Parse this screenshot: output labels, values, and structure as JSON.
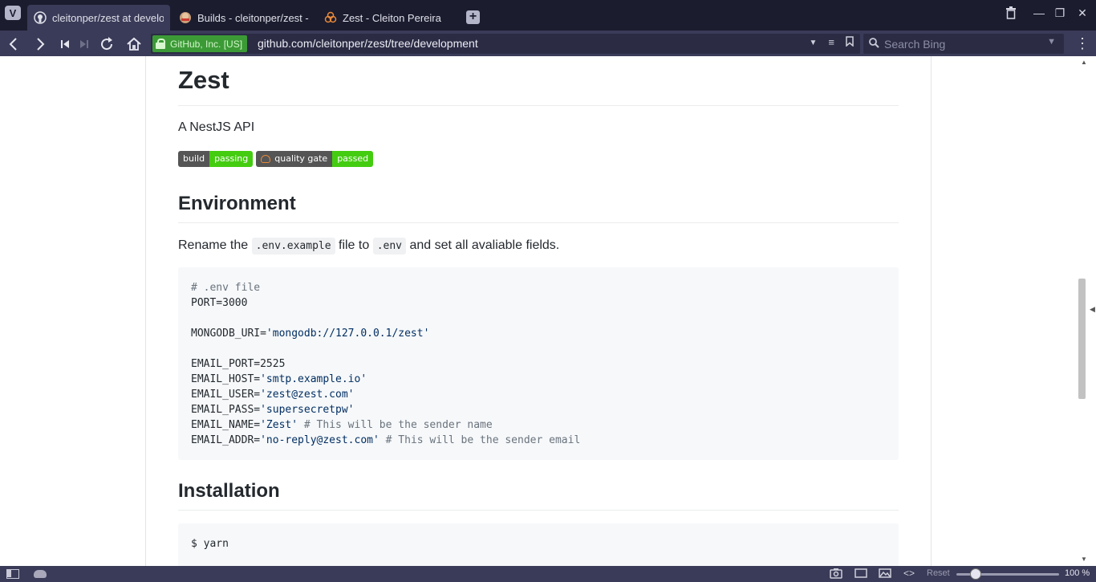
{
  "browser": {
    "menu_glyph": "V",
    "tabs": [
      {
        "label": "cleitonper/zest at development",
        "icon": "github-icon"
      },
      {
        "label": "Builds - cleitonper/zest - Travis CI",
        "icon": "travis-icon"
      },
      {
        "label": "Zest - Cleiton Pereira",
        "icon": "sonarcloud-icon"
      }
    ],
    "new_tab_glyph": "+",
    "window_buttons": {
      "trash": "🗑",
      "minimize": "—",
      "restore": "❐",
      "close": "✕"
    }
  },
  "address_bar": {
    "cert_label": "GitHub, Inc. [US]",
    "url": "github.com/cleitonper/zest/tree/development",
    "search_placeholder": "Search Bing",
    "nav": {
      "back": "‹",
      "forward": "›",
      "rewind": "⏮",
      "fastforward": "⏭",
      "reload": "↻",
      "home": "⌂"
    },
    "url_icons": {
      "dropdown": "▼",
      "reader": "≡",
      "bookmark": "🔖"
    },
    "search_icon": "🔍",
    "search_dropdown": "▼",
    "kebab": "⋮"
  },
  "readme": {
    "title": "Zest",
    "description": "A NestJS API",
    "badges": [
      {
        "left": "build",
        "right": "passing",
        "right_color": "#44cc11"
      },
      {
        "left": "quality gate",
        "right": "passed",
        "right_color": "#44cc11"
      }
    ],
    "environment": {
      "heading": "Environment",
      "text_before": "Rename the",
      "code1": ".env.example",
      "text_middle": "file to",
      "code2": ".env",
      "text_after": "and set all avaliable fields.",
      "lines": [
        {
          "key": "",
          "value": "",
          "comment": "# .env file"
        },
        {
          "key": "PORT=3000",
          "value": "",
          "comment": ""
        },
        {
          "key": "",
          "value": "",
          "comment": ""
        },
        {
          "key": "MONGODB_URI=",
          "value": "'mongodb://127.0.0.1/zest'",
          "comment": ""
        },
        {
          "key": "",
          "value": "",
          "comment": ""
        },
        {
          "key": "EMAIL_PORT=2525",
          "value": "",
          "comment": ""
        },
        {
          "key": "EMAIL_HOST=",
          "value": "'smtp.example.io'",
          "comment": ""
        },
        {
          "key": "EMAIL_USER=",
          "value": "'zest@zest.com'",
          "comment": ""
        },
        {
          "key": "EMAIL_PASS=",
          "value": "'supersecretpw'",
          "comment": ""
        },
        {
          "key": "EMAIL_NAME=",
          "value": "'Zest'",
          "comment": " # This will be the sender name"
        },
        {
          "key": "EMAIL_ADDR=",
          "value": "'no-reply@zest.com'",
          "comment": " # This will be the sender email"
        }
      ]
    },
    "installation": {
      "heading": "Installation",
      "command": "$ yarn"
    }
  },
  "status_bar": {
    "reset_label": "Reset",
    "zoom": "100 %",
    "zoom_level": 1.0,
    "icons": {
      "camera": "📷",
      "window": "▭",
      "image": "🖼",
      "code": "<>"
    }
  },
  "colors": {
    "chrome_dark": "#1b1c2e",
    "chrome": "#3a3b58",
    "badge_green": "#44cc11",
    "cert_green": "#3c9a36"
  }
}
